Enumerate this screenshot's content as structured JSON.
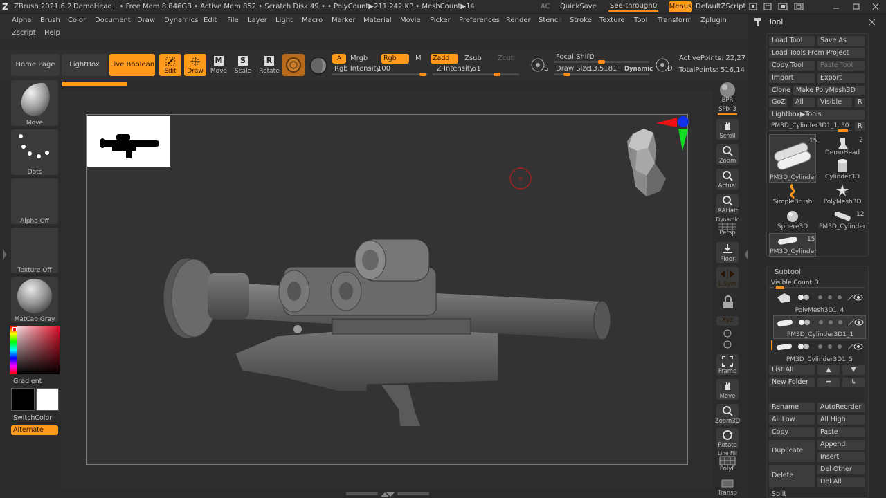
{
  "titlebar": {
    "app": "ZBrush 2021.6.2",
    "doc": "DemoHead",
    "stats": ".. • Free Mem 8.846GB • Active Mem 852 • Scratch Disk 49 • • PolyCount▶211.242 KP • MeshCount▶14",
    "ac": "AC",
    "quicksave": "QuickSave",
    "seethrough_label": "See-through",
    "seethrough_value": "0",
    "menus": "Menus",
    "zscript": "DefaultZScript"
  },
  "menubar": {
    "row1": [
      "Alpha",
      "Brush",
      "Color",
      "Document",
      "Draw",
      "Dynamics",
      "Edit",
      "File",
      "Layer",
      "Light",
      "Macro",
      "Marker",
      "Material",
      "Movie",
      "Picker",
      "Preferences",
      "Render",
      "Stencil",
      "Stroke",
      "Texture",
      "Tool",
      "Transform",
      "Zplugin"
    ],
    "row2": [
      "Zscript",
      "Help"
    ]
  },
  "toolbar": {
    "home_page": "Home Page",
    "lightbox": "LightBox",
    "live_boolean": "Live Boolean",
    "edit": "Edit",
    "draw": "Draw",
    "move": "Move",
    "scale": "Scale",
    "rotate": "Rotate",
    "a": "A",
    "mrgb": "Mrgb",
    "rgb": "Rgb",
    "m": "M",
    "zadd": "Zadd",
    "zsub": "Zsub",
    "zcut": "Zcut",
    "rgb_intensity_label": "Rgb Intensity",
    "rgb_intensity_value": "100",
    "z_intensity_label": "Z Intensity",
    "z_intensity_value": "51",
    "focal_shift_label": "Focal Shift",
    "focal_shift_value": "0",
    "draw_size_label": "Draw Size",
    "draw_size_value": "13.5181",
    "dynamic": "Dynamic",
    "s": "S",
    "d": "D",
    "active_points": "ActivePoints: 22,27",
    "total_points": "TotalPoints: 516,14"
  },
  "leftshelf": {
    "brush": "Move",
    "stroke": "Dots",
    "alpha": "Alpha Off",
    "texture": "Texture Off",
    "material": "MatCap Gray",
    "gradient": "Gradient",
    "switchcolor": "SwitchColor",
    "alternate": "Alternate"
  },
  "rightshelf": {
    "items": [
      "BPR",
      "SPix 3",
      "Scroll",
      "Zoom",
      "Actual",
      "AAHalf",
      "Persp",
      "Floor",
      "L.Sym",
      "Xyz",
      "Frame",
      "Move",
      "Zoom3D",
      "Rotate",
      "PolyF",
      "Transp"
    ],
    "dynamic_small": "Dynamic",
    "line_fill": "Line Fill"
  },
  "tool": {
    "title": "Tool",
    "load_tool": "Load Tool",
    "save_as": "Save As",
    "load_from_project": "Load Tools From Project",
    "copy_tool": "Copy Tool",
    "paste_tool": "Paste Tool",
    "import": "Import",
    "export": "Export",
    "clone": "Clone",
    "make_polymesh": "Make PolyMesh3D",
    "goz": "GoZ",
    "all": "All",
    "visible": "Visible",
    "r": "R",
    "lightbox_tools": "Lightbox▶Tools",
    "current_tool": "PM3D_Cylinder3D1_1.",
    "current_value": "50",
    "tools": [
      {
        "name": "PM3D_Cylinder",
        "count": "15"
      },
      {
        "name": "DemoHead",
        "count": "2"
      },
      {
        "name": "Cylinder3D",
        "count": ""
      },
      {
        "name": "SimpleBrush",
        "count": ""
      },
      {
        "name": "PolyMesh3D",
        "count": ""
      },
      {
        "name": "Sphere3D",
        "count": ""
      },
      {
        "name": "PM3D_Cylinder:",
        "count": "12"
      },
      {
        "name": "PM3D_Cylinder",
        "count": "15"
      }
    ]
  },
  "subtool": {
    "title": "Subtool",
    "visible_count": "Visible Count",
    "visible_count_value": "3",
    "items": [
      "PolyMesh3D1_4",
      "PM3D_Cylinder3D1_1",
      "PM3D_Cylinder3D1_5"
    ],
    "list_all": "List All",
    "new_folder": "New Folder",
    "rename": "Rename",
    "autoreorder": "AutoReorder",
    "all_low": "All Low",
    "all_high": "All High",
    "copy": "Copy",
    "paste": "Paste",
    "duplicate": "Duplicate",
    "append": "Append",
    "insert": "Insert",
    "delete": "Delete",
    "del_other": "Del Other",
    "del_all": "Del All",
    "split": "Split"
  },
  "colors": {
    "accent": "#ff9a1a",
    "panel": "#2a2a2a",
    "button": "#3a3a3a"
  }
}
